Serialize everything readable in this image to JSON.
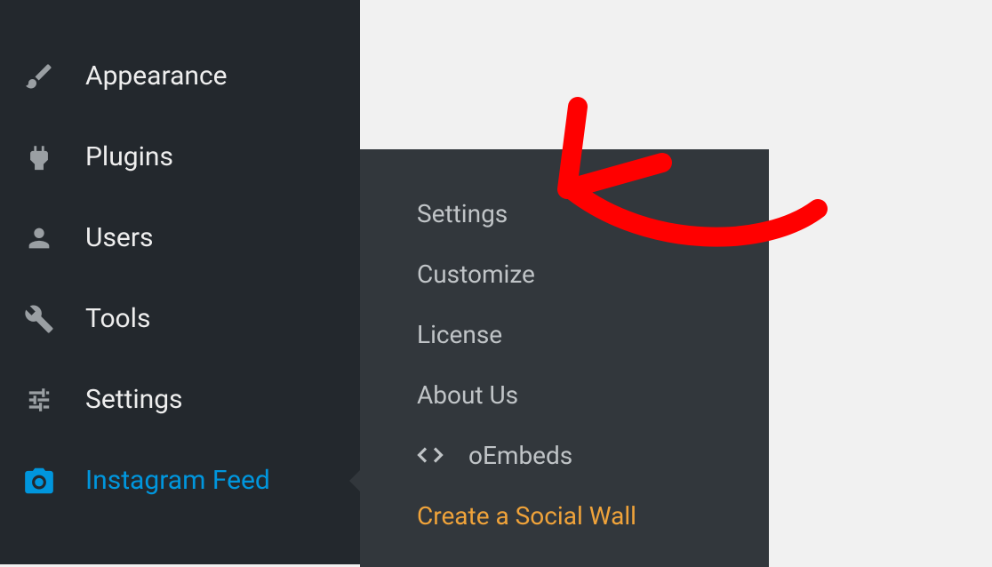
{
  "sidebar": {
    "items": [
      {
        "label": "Appearance"
      },
      {
        "label": "Plugins"
      },
      {
        "label": "Users"
      },
      {
        "label": "Tools"
      },
      {
        "label": "Settings"
      },
      {
        "label": "Instagram Feed"
      }
    ]
  },
  "submenu": {
    "items": [
      {
        "label": "Settings"
      },
      {
        "label": "Customize"
      },
      {
        "label": "License"
      },
      {
        "label": "About Us"
      },
      {
        "label": "oEmbeds"
      },
      {
        "label": "Create a Social Wall"
      }
    ]
  },
  "colors": {
    "accent": "#0096dd",
    "highlight": "#f0a33a",
    "annotation": "#ff0000"
  }
}
